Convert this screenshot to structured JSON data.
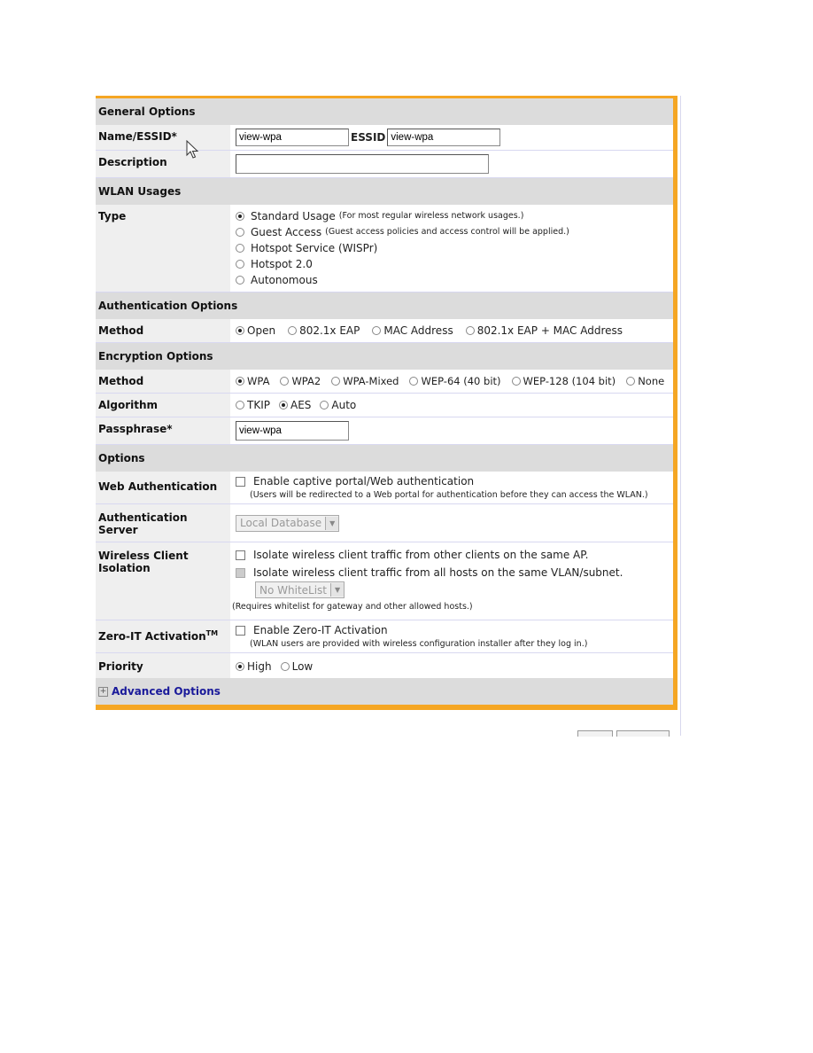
{
  "general": {
    "title": "General Options",
    "name_label": "Name/ESSID*",
    "name_value": "view-wpa",
    "essid_label": "ESSID",
    "essid_value": "view-wpa",
    "description_label": "Description",
    "description_value": ""
  },
  "wlan": {
    "title": "WLAN Usages",
    "type_label": "Type",
    "types": [
      {
        "label": "Standard Usage",
        "note": "(For most regular wireless network usages.)",
        "selected": true
      },
      {
        "label": "Guest Access",
        "note": "(Guest access policies and access control will be applied.)",
        "selected": false
      },
      {
        "label": "Hotspot Service (WISPr)",
        "note": "",
        "selected": false
      },
      {
        "label": "Hotspot 2.0",
        "note": "",
        "selected": false
      },
      {
        "label": "Autonomous",
        "note": "",
        "selected": false
      }
    ]
  },
  "auth": {
    "title": "Authentication Options",
    "method_label": "Method",
    "methods": [
      {
        "label": "Open",
        "selected": true
      },
      {
        "label": "802.1x EAP",
        "selected": false
      },
      {
        "label": "MAC Address",
        "selected": false
      },
      {
        "label": "802.1x EAP + MAC Address",
        "selected": false
      }
    ]
  },
  "encryption": {
    "title": "Encryption Options",
    "method_label": "Method",
    "methods": [
      {
        "label": "WPA",
        "selected": true
      },
      {
        "label": "WPA2",
        "selected": false
      },
      {
        "label": "WPA-Mixed",
        "selected": false
      },
      {
        "label": "WEP-64 (40 bit)",
        "selected": false
      },
      {
        "label": "WEP-128 (104 bit)",
        "selected": false
      },
      {
        "label": "None",
        "selected": false
      }
    ],
    "algorithm_label": "Algorithm",
    "algorithms": [
      {
        "label": "TKIP",
        "selected": false
      },
      {
        "label": "AES",
        "selected": true
      },
      {
        "label": "Auto",
        "selected": false
      }
    ],
    "passphrase_label": "Passphrase*",
    "passphrase_value": "view-wpa"
  },
  "options": {
    "title": "Options",
    "web_auth_label": "Web Authentication",
    "web_auth_checkbox": "Enable captive portal/Web authentication",
    "web_auth_note": "(Users will be redirected to a Web portal for authentication before they can access the WLAN.)",
    "auth_server_label": "Authentication Server",
    "auth_server_value": "Local Database",
    "isolation_label": "Wireless Client Isolation",
    "isolation_ap": "Isolate wireless client traffic from other clients on the same AP.",
    "isolation_vlan": "Isolate wireless client traffic from all hosts on the same VLAN/subnet.",
    "whitelist_value": "No WhiteList",
    "whitelist_note": "(Requires whitelist for gateway and other allowed hosts.)",
    "zeroit_label": "Zero-IT Activation",
    "zeroit_tm": "TM",
    "zeroit_checkbox": "Enable Zero-IT Activation",
    "zeroit_note": "(WLAN users are provided with wireless configuration installer after they log in.)",
    "priority_label": "Priority",
    "priorities": [
      {
        "label": "High",
        "selected": true
      },
      {
        "label": "Low",
        "selected": false
      }
    ]
  },
  "advanced": {
    "label": "Advanced Options",
    "expand_symbol": "+"
  },
  "colors": {
    "accent": "#f5a623",
    "section_bg": "#dcdcdc",
    "label_bg": "#efefef",
    "link": "#1a1a9a"
  }
}
